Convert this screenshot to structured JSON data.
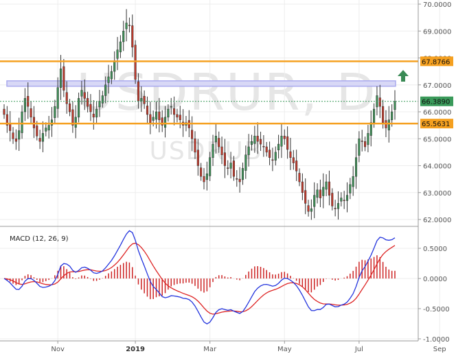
{
  "chart_data": [
    {
      "type": "candlestick",
      "title": "USDRUR, D",
      "watermark": {
        "main": "USDRUR, D",
        "sub": "USDRUB"
      },
      "ylim": [
        61.8,
        70.1
      ],
      "y_ticks": [
        "62.0000",
        "63.0000",
        "64.0000",
        "65.0000",
        "66.0000",
        "67.0000",
        "68.0000",
        "69.0000",
        "70.0000"
      ],
      "x_ticks": [
        {
          "label": "Nov",
          "bold": false,
          "i": 18
        },
        {
          "label": "2019",
          "bold": true,
          "i": 44
        },
        {
          "label": "Mar",
          "bold": false,
          "i": 69
        },
        {
          "label": "May",
          "bold": false,
          "i": 94
        },
        {
          "label": "Jul",
          "bold": false,
          "i": 119
        },
        {
          "label": "Sep",
          "bold": false,
          "i": 146
        }
      ],
      "levels": [
        {
          "value": 67.8766,
          "label": "67.8766",
          "color": "#f5a020",
          "style": "solid"
        },
        {
          "value": 65.5631,
          "label": "65.5631",
          "color": "#f5a020",
          "style": "solid"
        },
        {
          "value": 66.389,
          "label": "66.3890",
          "color": "#3a9a5a",
          "style": "dotted"
        }
      ],
      "resistance_zone": {
        "from": 66.95,
        "to": 67.15,
        "color": "#aaaaee"
      },
      "arrow": {
        "direction": "up",
        "color": "#3a8a55"
      },
      "colors": {
        "up": "#3d8f56",
        "down": "#c0392b"
      },
      "close": [
        65.9,
        65.5,
        65.3,
        65.0,
        64.9,
        65.3,
        66.0,
        66.5,
        66.2,
        65.8,
        65.4,
        65.1,
        64.9,
        65.2,
        65.4,
        65.5,
        65.7,
        66.2,
        66.9,
        67.6,
        66.8,
        66.3,
        66.0,
        65.5,
        65.8,
        66.5,
        66.8,
        66.5,
        66.2,
        66.0,
        65.8,
        66.1,
        66.4,
        66.6,
        67.0,
        67.3,
        67.5,
        67.9,
        68.3,
        68.6,
        69.0,
        69.3,
        69.2,
        68.4,
        67.2,
        66.4,
        66.5,
        66.3,
        65.9,
        65.6,
        65.8,
        66.0,
        65.7,
        65.5,
        65.8,
        66.1,
        66.2,
        65.9,
        65.8,
        65.7,
        65.5,
        65.6,
        65.4,
        65.0,
        64.5,
        64.0,
        63.6,
        63.4,
        63.7,
        64.3,
        64.8,
        65.1,
        64.7,
        64.4,
        64.0,
        63.9,
        64.1,
        63.6,
        63.5,
        63.4,
        63.9,
        64.4,
        64.7,
        64.9,
        65.1,
        64.9,
        64.8,
        64.7,
        64.5,
        64.3,
        64.2,
        64.5,
        64.8,
        65.1,
        65.0,
        64.6,
        64.3,
        64.1,
        63.8,
        63.4,
        63.0,
        62.6,
        62.3,
        62.4,
        62.9,
        63.1,
        62.8,
        63.2,
        63.4,
        62.9,
        62.5,
        62.4,
        62.6,
        62.8,
        62.7,
        62.9,
        63.3,
        63.6,
        64.3,
        65.0,
        64.9,
        64.7,
        65.2,
        65.6,
        66.1,
        66.6,
        66.2,
        65.6,
        65.4,
        65.7,
        66.0,
        66.389
      ],
      "macd_panel": {
        "title": "MACD (12, 26, 9)",
        "ylim": [
          -1.0,
          0.95
        ],
        "y_ticks": [
          "0.5000",
          "0.0000",
          "-0.5000",
          "-1.0000"
        ],
        "macd_color": "#2233dd",
        "signal_color": "#dd2222",
        "histogram_color": "#cc2222"
      }
    }
  ]
}
